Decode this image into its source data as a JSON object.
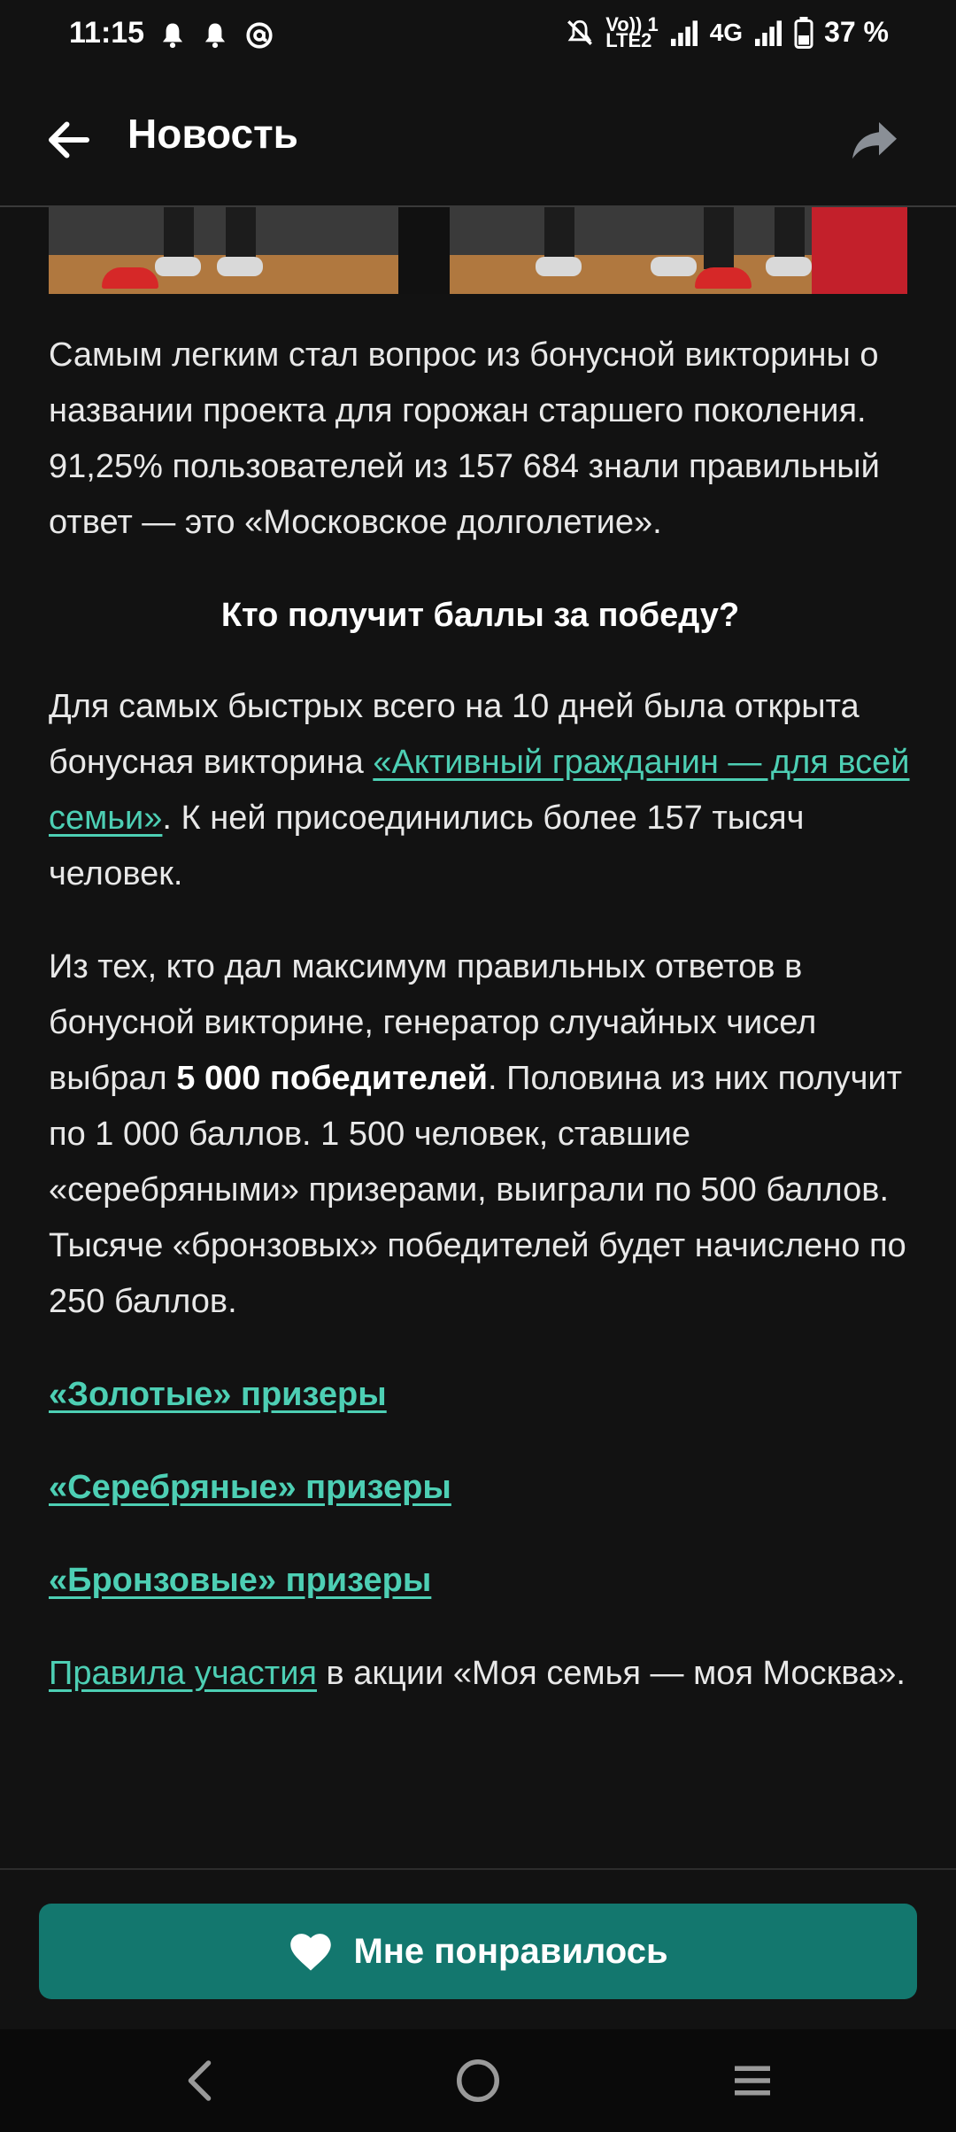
{
  "status_bar": {
    "time": "11:15",
    "left_icons": [
      "bell-icon",
      "bell-icon",
      "at-icon"
    ],
    "lte_top": "Vo)) 1",
    "lte_bottom": "LTE2",
    "network": "4G",
    "battery": "37 %"
  },
  "app_bar": {
    "title": "Новость",
    "back_icon": "arrow-left-icon",
    "share_icon": "share-arrow-icon"
  },
  "article": {
    "p1": "Самым легким стал вопрос из бонусной викторины о названии проекта для горожан старшего поколения. 91,25% пользователей из 157 684 знали правильный ответ — это «Московское долголетие».",
    "heading": "Кто получит баллы за победу?",
    "p2_before": "Для самых быстрых всего на 10 дней была открыта бонусная викторина ",
    "p2_link": "«Активный гражданин — для всей семьи»",
    "p2_after": ". К ней присоединились более 157 тысяч человек.",
    "p3_before": "Из тех, кто дал максимум правильных ответов в бонусной викторине, генератор случайных чисел выбрал ",
    "p3_bold": "5 000 победителей",
    "p3_after": ". Половина из них получит по 1 000 баллов. 1 500 человек, ставшие «серебряными» призерами, выиграли по 500 баллов. Тысяче «бронзовых» победителей будет начислено по 250 баллов.",
    "link_gold": "«Золотые» призеры",
    "link_silver": "«Серебряные» призеры",
    "link_bronze": "«Бронзовые» призеры",
    "rules_link": "Правила участия",
    "rules_after": " в акции «Моя семья — моя Москва»."
  },
  "like_button": {
    "label": "Мне понравилось",
    "icon": "heart-icon"
  },
  "colors": {
    "background": "#121212",
    "link": "#4dcfb4",
    "accent": "#13776e"
  }
}
